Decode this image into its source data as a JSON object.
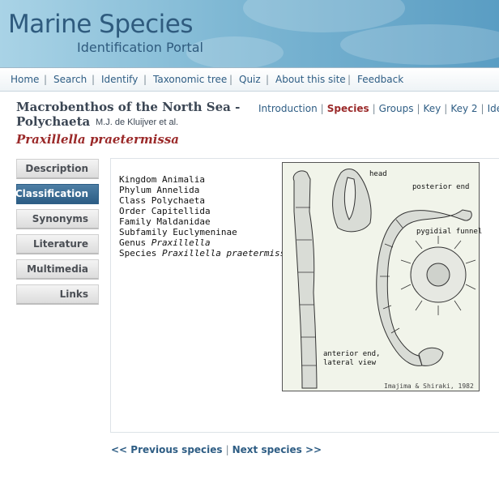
{
  "banner": {
    "title": "Marine Species",
    "subtitle": "Identification Portal"
  },
  "topnav": {
    "items": [
      "Home",
      "Search",
      "Identify",
      "Taxonomic tree",
      "Quiz",
      "About this site",
      "Feedback"
    ],
    "separator": "|"
  },
  "header": {
    "title_line1": "Macrobenthos of the North Sea -",
    "title_line2": "Polychaeta",
    "authors": "M.J. de Kluijver et al.",
    "species": "Praxillella praetermissa"
  },
  "subnav": {
    "items": [
      "Introduction",
      "Species",
      "Groups",
      "Key",
      "Key 2",
      "Identi"
    ],
    "active": "Species"
  },
  "sidetabs": {
    "items": [
      "Description",
      "Classification",
      "Synonyms",
      "Literature",
      "Multimedia",
      "Links"
    ],
    "active": "Classification"
  },
  "classification": [
    {
      "rank": "Kingdom",
      "name": "Animalia",
      "italic": false
    },
    {
      "rank": "Phylum",
      "name": "Annelida",
      "italic": false
    },
    {
      "rank": "Class",
      "name": "Polychaeta",
      "italic": false
    },
    {
      "rank": "Order",
      "name": "Capitellida",
      "italic": false
    },
    {
      "rank": "Family",
      "name": "Maldanidae",
      "italic": false
    },
    {
      "rank": "Subfamily",
      "name": "Euclymeninae",
      "italic": false
    },
    {
      "rank": "Genus",
      "name": "Praxillella",
      "italic": true
    },
    {
      "rank": "Species",
      "name": "Praxillella praetermissa",
      "italic": true
    }
  ],
  "figure": {
    "labels": {
      "head": "head",
      "posterior_end": "posterior end",
      "pygidial_funnel": "pygidial funnel",
      "anterior_end_1": "anterior end,",
      "anterior_end_2": "lateral view",
      "credit": "Imajima & Shiraki, 1982"
    }
  },
  "bottomnav": {
    "prev": "<< Previous species",
    "separator": "|",
    "next": "Next species >>"
  },
  "colors": {
    "link": "#2e5d84",
    "active_red": "#9b2a2a",
    "tab_active": "#2d5e86"
  }
}
